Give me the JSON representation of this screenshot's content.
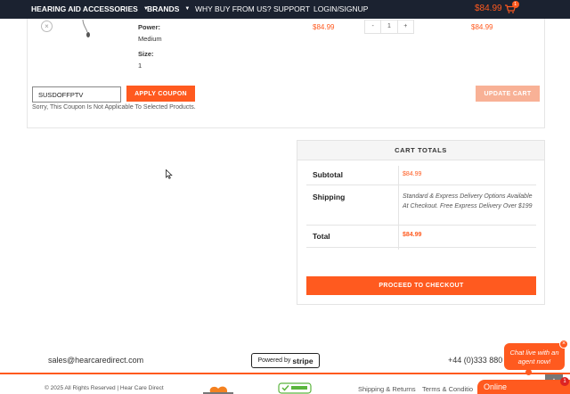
{
  "nav": {
    "items": [
      {
        "label": "HEARING AID ACCESSORIES",
        "has_caret": true
      },
      {
        "label": "BRANDS",
        "has_caret": true
      },
      {
        "label": "WHY BUY FROM US?"
      },
      {
        "label": "SUPPORT"
      },
      {
        "label": "LOGIN/SIGNUP"
      }
    ],
    "cart_total": "$84.99",
    "cart_count": "1",
    "cart_icon": "cart-icon"
  },
  "cart_item": {
    "remove_glyph": "×",
    "power_label": "Power:",
    "power_value": "Medium",
    "size_label": "Size:",
    "size_value": "1",
    "price": "$84.99",
    "qty_minus": "-",
    "qty_value": "1",
    "qty_plus": "+",
    "subtotal": "$84.99"
  },
  "coupon": {
    "value": "SUSDOFFPTV",
    "apply_label": "APPLY COUPON",
    "message": "Sorry, This Coupon Is Not Applicable To Selected Products.",
    "update_label": "UPDATE CART"
  },
  "totals": {
    "heading": "CART TOTALS",
    "subtotal_label": "Subtotal",
    "subtotal_value": "$84.99",
    "shipping_label": "Shipping",
    "shipping_text": "Standard & Express Delivery Options Available At Checkout. Free Express Delivery Over $199",
    "total_label": "Total",
    "total_value": "$84.99",
    "checkout_label": "PROCEED TO CHECKOUT"
  },
  "footer": {
    "email": "sales@hearcaredirect.com",
    "powered_by": "Powered by",
    "stripe": "stripe",
    "phone": "+44 (0)333 880",
    "copyright": "© 2025 All Rights Reserved | Hear Care Direct",
    "links": [
      "Shipping & Returns",
      "Terms & Conditio"
    ]
  },
  "chat": {
    "bubble": "Chat live with an agent now!",
    "close": "×",
    "online": "Online",
    "count": "1",
    "scroll_top": "▲"
  },
  "colors": {
    "accent": "#ff5a1f",
    "nav_bg": "#1b2230",
    "update_disabled": "#f8b196"
  }
}
